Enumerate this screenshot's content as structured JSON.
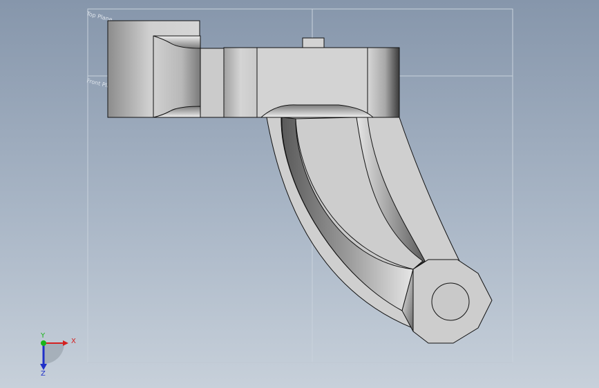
{
  "viewport": {
    "background_top": "#8696ab",
    "background_bottom": "#c7d0da"
  },
  "planes": {
    "label_top": "Top Plane",
    "label_front": "Front Plane"
  },
  "triad": {
    "x_label": "X",
    "y_label": "Y",
    "z_label": "Z",
    "x_color": "#d42020",
    "y_color": "#19b519",
    "z_color": "#2030c8"
  },
  "part": {
    "face_color": "#cfcfcf",
    "edge_color": "#111111"
  }
}
